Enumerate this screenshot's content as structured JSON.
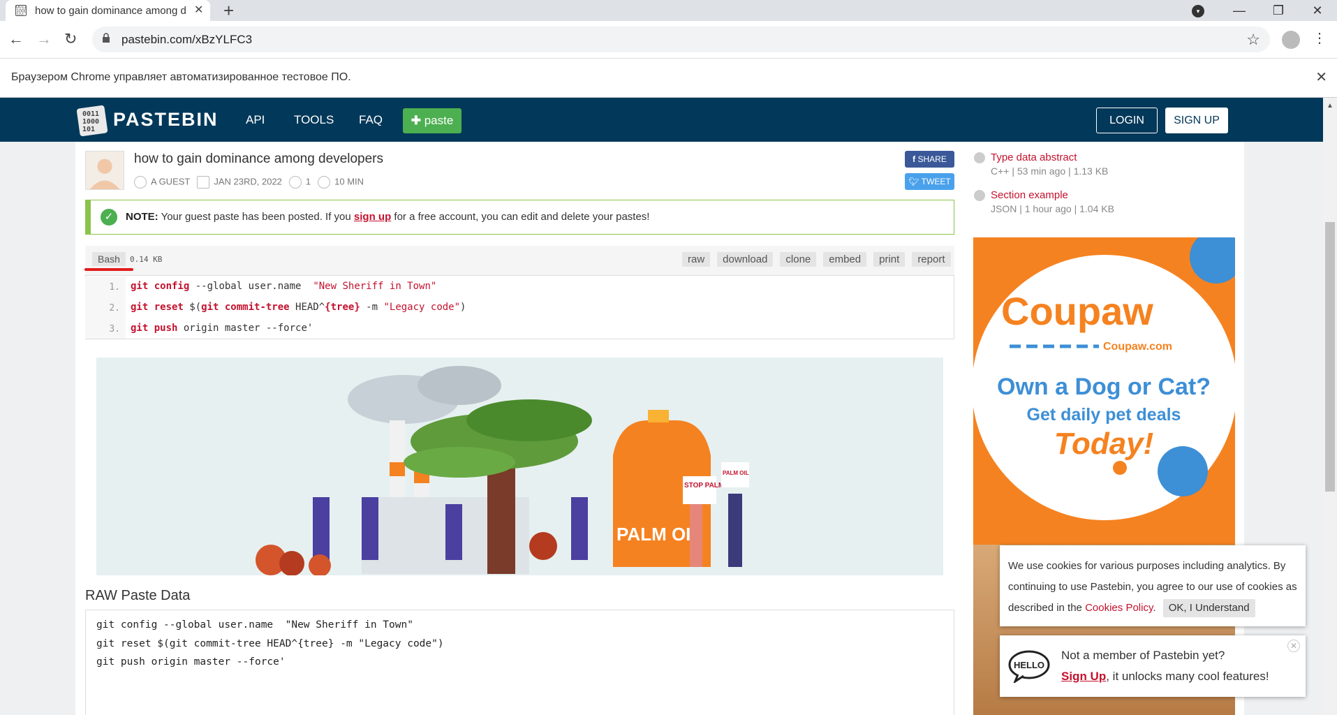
{
  "browser": {
    "tab_title": "how to gain dominance among d",
    "url": "pastebin.com/xBzYLFC3",
    "infobar_text": "Браузером Chrome управляет автоматизированное тестовое ПО."
  },
  "header": {
    "brand": "PASTEBIN",
    "nav": [
      "API",
      "TOOLS",
      "FAQ"
    ],
    "paste_label": "paste",
    "login_label": "LOGIN",
    "signup_label": "SIGN UP"
  },
  "paste": {
    "title": "how to gain dominance among developers",
    "author": "A GUEST",
    "date": "JAN 23RD, 2022",
    "views": "1",
    "expires": "10 MIN",
    "share_label": "SHARE",
    "tweet_label": "TWEET",
    "note_bold": "NOTE:",
    "note_text1": "Your guest paste has been posted. If you",
    "note_link": "sign up",
    "note_text2": "for a free account, you can edit and delete your pastes!",
    "language": "Bash",
    "size": "0.14 KB",
    "actions": [
      "raw",
      "download",
      "clone",
      "embed",
      "print",
      "report"
    ],
    "line_numbers": [
      "1.",
      "2.",
      "3."
    ],
    "raw_title": "RAW Paste Data",
    "raw_lines": [
      "git config --global user.name  \"New Sheriff in Town\"",
      "git reset $(git commit-tree HEAD^{tree} -m \"Legacy code\")",
      "git push origin master --force'"
    ]
  },
  "banner": {
    "sign1": "STOP PALM OIL",
    "sign2": "PALM OIL",
    "jug_label": "PALM OIL"
  },
  "sidebar": {
    "items": [
      {
        "title": "Type data abstract",
        "meta": "C++ | 53 min ago | 1.13 KB"
      },
      {
        "title": "Section example",
        "meta": "JSON | 1 hour ago | 1.04 KB"
      }
    ],
    "ad": {
      "brand": "Coupaw",
      "domain": "Coupaw.com",
      "line1": "Own a Dog or Cat?",
      "line2": "Get daily pet deals",
      "line3": "Today!"
    }
  },
  "cookie": {
    "text": "We use cookies for various purposes including analytics. By continuing to use Pastebin, you agree to our use of cookies as described in the",
    "link": "Cookies Policy",
    "ok_label": "OK, I Understand"
  },
  "member": {
    "hello": "HELLO",
    "question": "Not a member of Pastebin yet?",
    "signup_link": "Sign Up",
    "tail": ", it unlocks many cool features!"
  }
}
